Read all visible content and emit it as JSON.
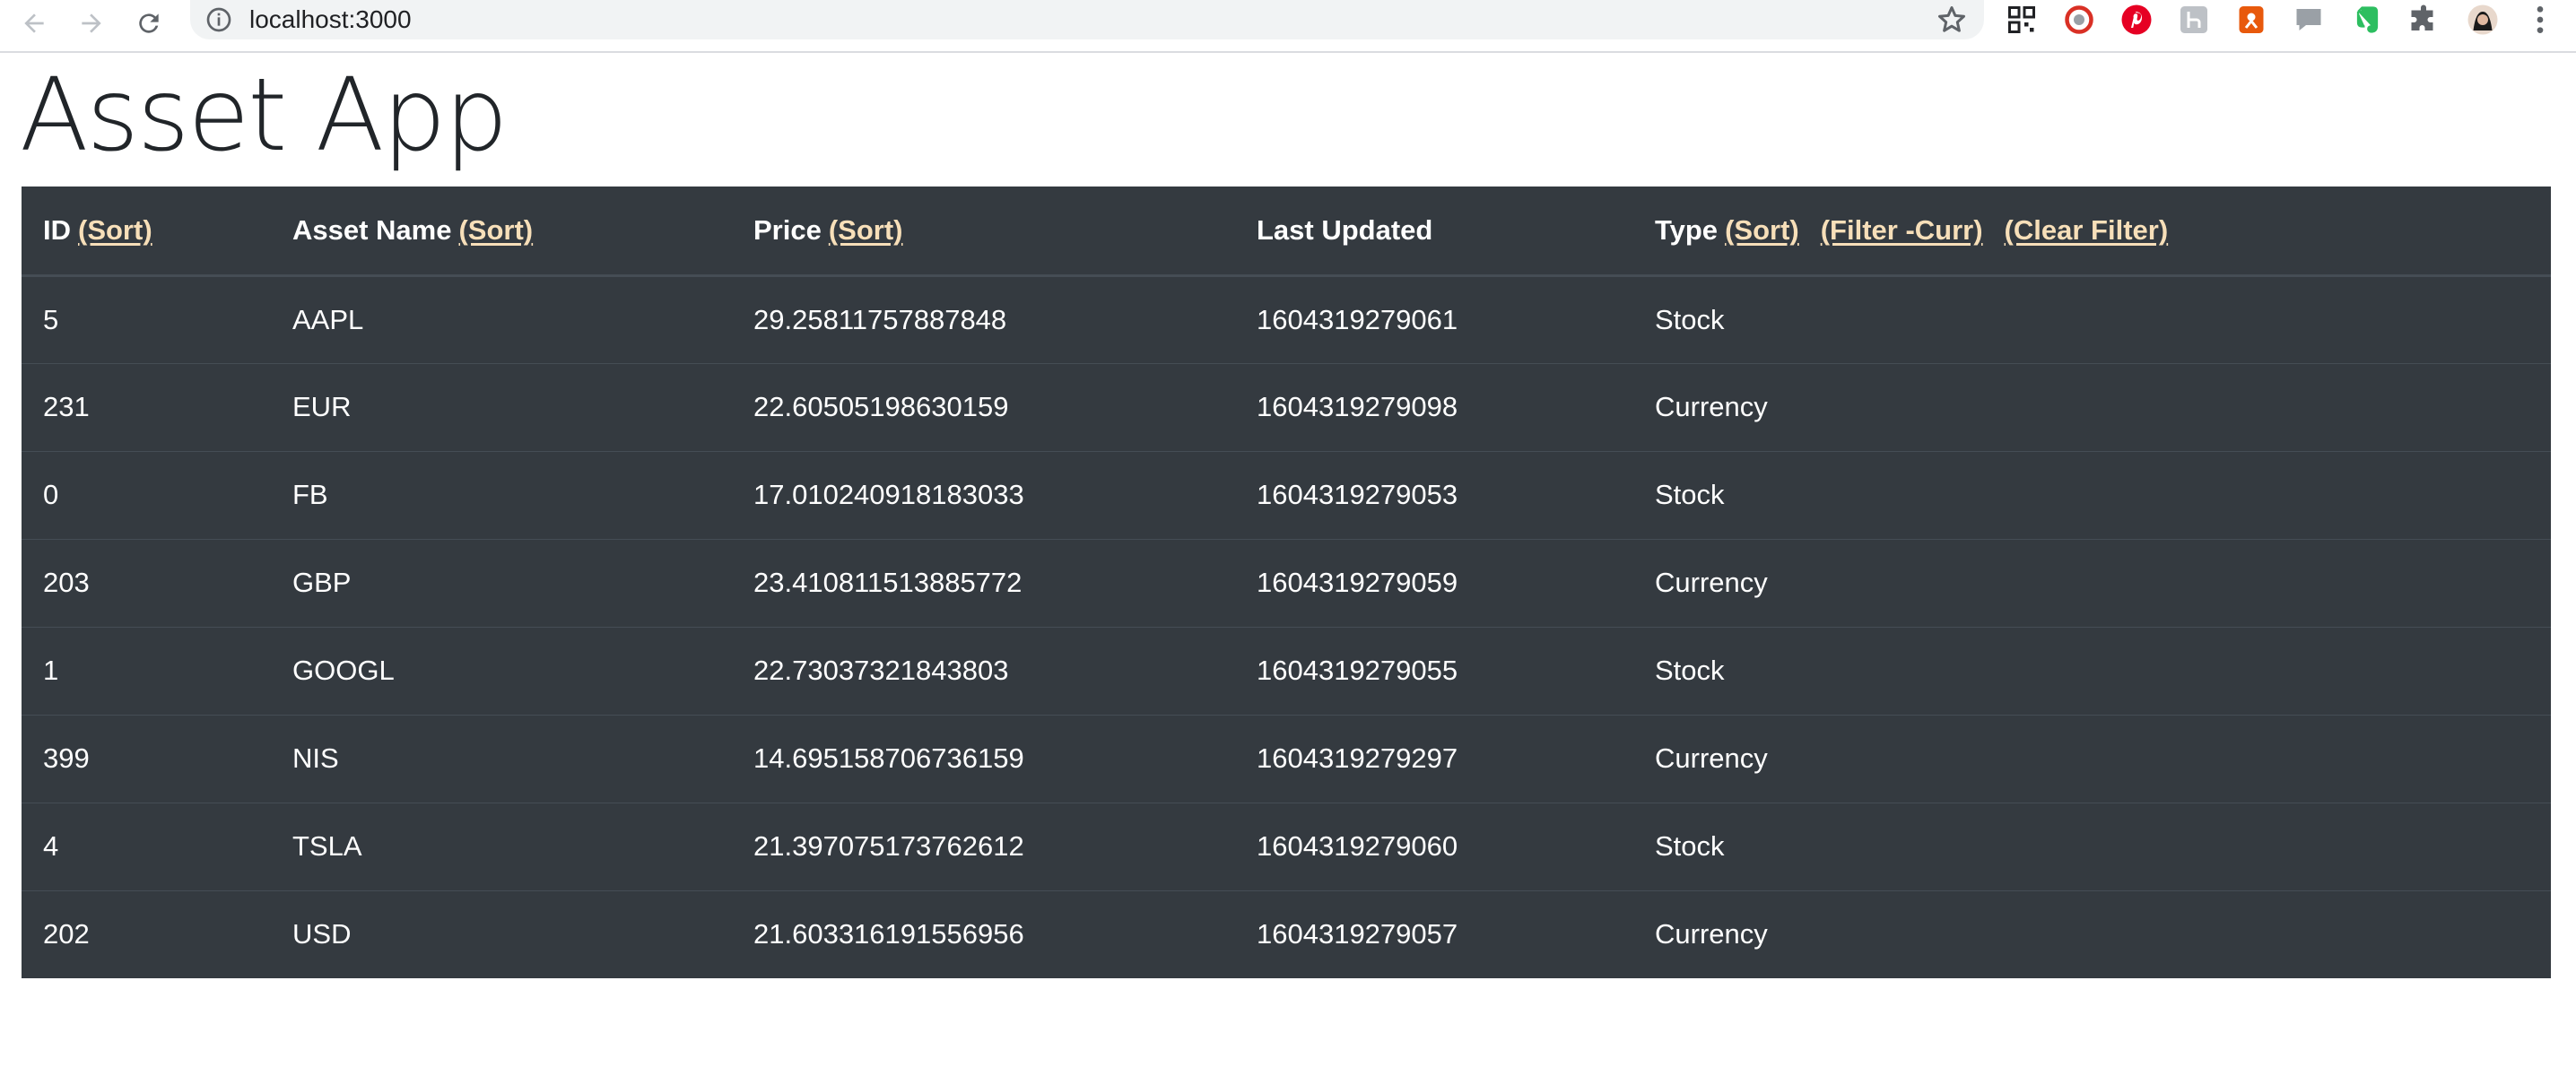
{
  "browser": {
    "url": "localhost:3000",
    "icons": [
      "back-icon",
      "forward-icon",
      "reload-icon",
      "info-icon",
      "bookmark-star-icon",
      "qr-extension-icon",
      "red-circle-extension-icon",
      "pinterest-icon",
      "gray-h-extension-icon",
      "orange-extension-icon",
      "chat-extension-icon",
      "evernote-icon",
      "puzzle-extensions-icon",
      "profile-avatar",
      "kebab-menu-icon"
    ]
  },
  "page": {
    "title": "Asset App"
  },
  "table": {
    "headers": {
      "id": "ID",
      "name": "Asset Name",
      "price": "Price",
      "updated": "Last Updated",
      "type": "Type"
    },
    "sort_label": "(Sort)",
    "filter_curr_label": "(Filter -Curr)",
    "clear_filter_label": "(Clear Filter)",
    "rows": [
      {
        "id": "5",
        "name": "AAPL",
        "price": "29.25811757887848",
        "updated": "1604319279061",
        "type": "Stock"
      },
      {
        "id": "231",
        "name": "EUR",
        "price": "22.60505198630159",
        "updated": "1604319279098",
        "type": "Currency"
      },
      {
        "id": "0",
        "name": "FB",
        "price": "17.010240918183033",
        "updated": "1604319279053",
        "type": "Stock"
      },
      {
        "id": "203",
        "name": "GBP",
        "price": "23.410811513885772",
        "updated": "1604319279059",
        "type": "Currency"
      },
      {
        "id": "1",
        "name": "GOOGL",
        "price": "22.73037321843803",
        "updated": "1604319279055",
        "type": "Stock"
      },
      {
        "id": "399",
        "name": "NIS",
        "price": "14.695158706736159",
        "updated": "1604319279297",
        "type": "Currency"
      },
      {
        "id": "4",
        "name": "TSLA",
        "price": "21.397075173762612",
        "updated": "1604319279060",
        "type": "Stock"
      },
      {
        "id": "202",
        "name": "USD",
        "price": "21.603316191556956",
        "updated": "1604319279057",
        "type": "Currency"
      }
    ]
  },
  "colors": {
    "table_bg": "#343a40",
    "link": "#f7dfb9",
    "row_border": "#454d55"
  }
}
